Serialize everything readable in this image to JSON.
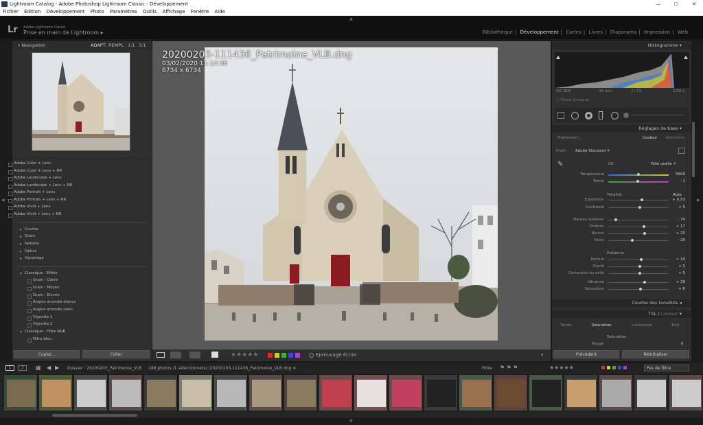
{
  "window": {
    "title": "Lightroom Catalog - Adobe Photoshop Lightroom Classic - Développement"
  },
  "menu": [
    "Fichier",
    "Edition",
    "Développement",
    "Photo",
    "Paramètres",
    "Outils",
    "Affichage",
    "Fenêtre",
    "Aide"
  ],
  "identity": {
    "logo": "Lr",
    "subtitle": "Adobe Lightroom Classic",
    "name": "Prise en main de Lightroom",
    "arrow": "▸"
  },
  "modules": [
    "Bibliothèque",
    "Développement",
    "Cartes",
    "Livres",
    "Diaporama",
    "Impression",
    "Web"
  ],
  "active_module": "Développement",
  "navigator": {
    "title": "Navigation",
    "opts": [
      "ADAPT.",
      "REMPL.",
      "1:1",
      "3:1"
    ]
  },
  "presets": [
    "Adobe Color + Lens",
    "Adobe Color + Lens + NR",
    "Adobe Landscape + Lens",
    "Adobe Landscape + Lens + NR",
    "Adobe Portrait + Lens",
    "Adobe Portrait + Lens + NR",
    "Adobe Vivid + Lens",
    "Adobe Vivid + Lens + NR"
  ],
  "groups": [
    "Courbe",
    "Grain",
    "Netteté",
    "Optics",
    "Vignetage"
  ],
  "effects_group": "Classique - Effets",
  "effects": [
    "Grain - Claire",
    "Grain - Moyen",
    "Grain - Elevée",
    "Angles arrondis blancs",
    "Angles arrondis noirs",
    "Vignette 1",
    "Vignette 2"
  ],
  "bw_group": "Classique - Filtre N&B",
  "bw": [
    "Filtre bleu"
  ],
  "left_buttons": {
    "copy": "Copier...",
    "paste": "Coller"
  },
  "photo": {
    "filename": "20200203-111436_Patrimoine_VLB.dng",
    "date": "03/02/2020 11:14:36",
    "dims": "6734 x 6734"
  },
  "toolbar": {
    "stars": "★★★★★",
    "softproof": "Epreuvage écran"
  },
  "histogram": {
    "title": "Histogramme",
    "iso": "ISO 800",
    "focal": "44 mm",
    "aperture": "ƒ / 11",
    "shutter": "1/50 s",
    "orig": "Photo d'origine"
  },
  "basic": {
    "title": "Réglages de base",
    "treatment": "Traitement :",
    "color": "Couleur",
    "bw": "Noir/blanc",
    "profile_label": "Profil :",
    "profile": "Adobe Standard ≑",
    "wb_label": "BB :",
    "wb": "Telle quelle ≑",
    "tone": "Tonalité",
    "auto": "Auto",
    "presence": "Présence",
    "sliders": [
      {
        "label": "Température",
        "value": "5600",
        "pos": 0.5
      },
      {
        "label": "Teinte",
        "value": "- 1",
        "pos": 0.49
      },
      {
        "label": "Exposition",
        "value": "+ 0,53",
        "pos": 0.56
      },
      {
        "label": "Contraste",
        "value": "+ 5",
        "pos": 0.52
      },
      {
        "label": "Hautes lumières",
        "value": "- 74",
        "pos": 0.13
      },
      {
        "label": "Ombres",
        "value": "+ 17",
        "pos": 0.59
      },
      {
        "label": "Blancs",
        "value": "+ 20",
        "pos": 0.6
      },
      {
        "label": "Noirs",
        "value": "- 20",
        "pos": 0.4
      },
      {
        "label": "Texture",
        "value": "+ 10",
        "pos": 0.55
      },
      {
        "label": "Clarté",
        "value": "+ 5",
        "pos": 0.52
      },
      {
        "label": "Correction du voile",
        "value": "+ 5",
        "pos": 0.52
      },
      {
        "label": "Vibrance",
        "value": "+ 20",
        "pos": 0.6
      },
      {
        "label": "Saturation",
        "value": "+ 6",
        "pos": 0.53
      }
    ]
  },
  "tone_curve": {
    "title": "Courbe des tonalités"
  },
  "hsl": {
    "title": "TSL",
    "subtitle": "Couleur",
    "tabs": [
      "Teinte",
      "Saturation",
      "Luminance",
      "Tout"
    ],
    "section": "Saturation",
    "red_label": "Rouge",
    "red_value": "0"
  },
  "right_buttons": {
    "prev": "Précédent",
    "reset": "Réinitialiser"
  },
  "filmstrip": {
    "source": "Dossier : 20200203_Patrimoine_VLB",
    "count": "188 photos /1 sélectionné(s) /20200203-111436_Patrimoine_VLB.dng ≑",
    "filter_label": "Filtre :",
    "filter_value": "Pas de filtre"
  },
  "colors": {
    "accent": "#cccccc",
    "bg": "#1b1b1b",
    "panel": "#2f2f2f"
  }
}
